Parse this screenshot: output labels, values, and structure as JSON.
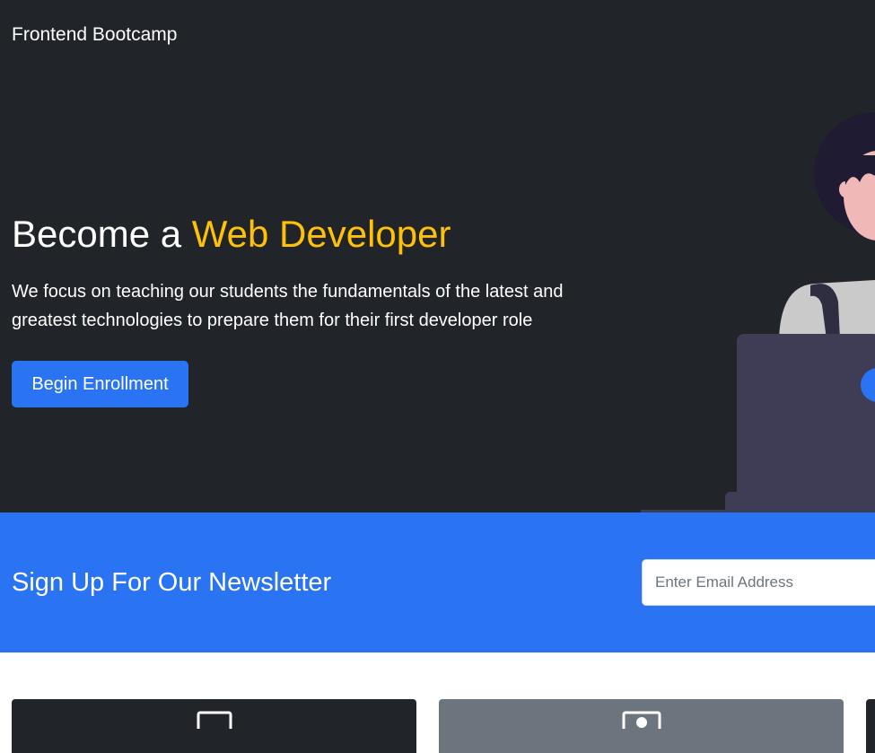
{
  "navbar": {
    "brand": "Frontend Bootcamp"
  },
  "hero": {
    "title_prefix": "Become a ",
    "title_accent": "Web Developer",
    "lead": "We focus on teaching our students the fundamentals of the latest and greatest technologies to prepare them for their first developer role",
    "cta_label": "Begin Enrollment"
  },
  "newsletter": {
    "title": "Sign Up For Our Newsletter",
    "email_placeholder": "Enter Email Address"
  },
  "cards": [
    {
      "icon": "laptop-icon"
    },
    {
      "icon": "person-icon"
    }
  ],
  "colors": {
    "dark_bg": "#212529",
    "primary": "#2a74f4",
    "accent": "#ffc107",
    "secondary": "#6c757d"
  }
}
